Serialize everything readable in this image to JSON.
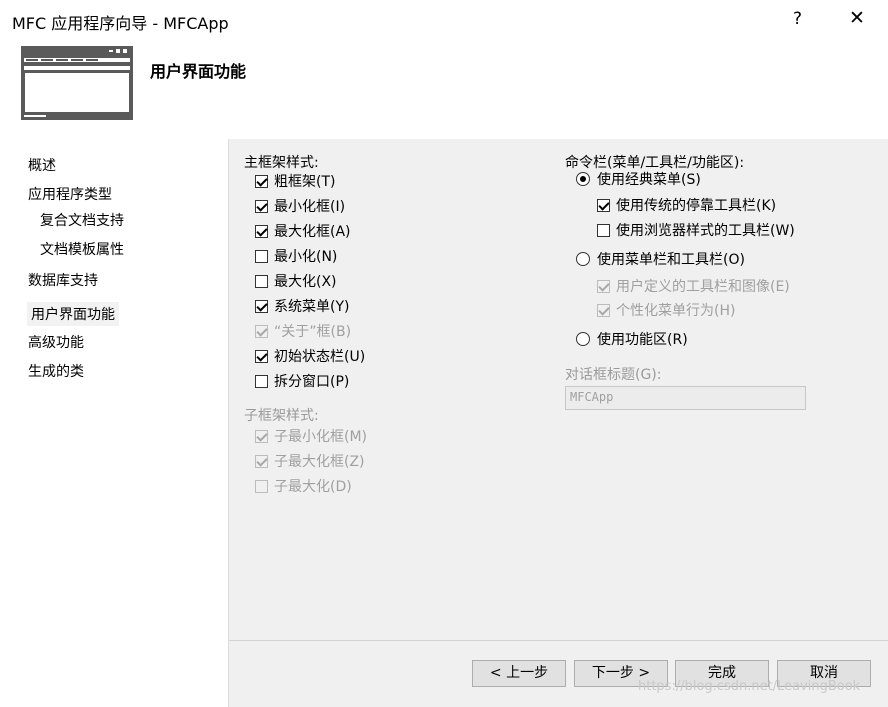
{
  "window": {
    "title": "MFC 应用程序向导 - MFCApp",
    "help_label": "?",
    "close_label": "✕"
  },
  "header": {
    "page_title": "用户界面功能"
  },
  "sidebar": {
    "items": [
      {
        "label": "概述"
      },
      {
        "label": "应用程序类型"
      },
      {
        "label": "复合文档支持"
      },
      {
        "label": "文档模板属性"
      },
      {
        "label": "数据库支持"
      },
      {
        "label": "用户界面功能",
        "selected": true
      },
      {
        "label": "高级功能"
      },
      {
        "label": "生成的类"
      }
    ]
  },
  "main_frame": {
    "label": "主框架样式:",
    "options": [
      {
        "label": "粗框架(T)",
        "checked": true,
        "enabled": true
      },
      {
        "label": "最小化框(I)",
        "checked": true,
        "enabled": true
      },
      {
        "label": "最大化框(A)",
        "checked": true,
        "enabled": true
      },
      {
        "label": "最小化(N)",
        "checked": false,
        "enabled": true
      },
      {
        "label": "最大化(X)",
        "checked": false,
        "enabled": true
      },
      {
        "label": "系统菜单(Y)",
        "checked": true,
        "enabled": true
      },
      {
        "label": "“关于”框(B)",
        "checked": true,
        "enabled": false
      },
      {
        "label": "初始状态栏(U)",
        "checked": true,
        "enabled": true
      },
      {
        "label": "拆分窗口(P)",
        "checked": false,
        "enabled": true
      }
    ]
  },
  "child_frame": {
    "label": "子框架样式:",
    "options": [
      {
        "label": "子最小化框(M)",
        "checked": true,
        "enabled": false
      },
      {
        "label": "子最大化框(Z)",
        "checked": true,
        "enabled": false
      },
      {
        "label": "子最大化(D)",
        "checked": false,
        "enabled": false
      }
    ]
  },
  "command_bar": {
    "label": "命令栏(菜单/工具栏/功能区):",
    "classic_menu": {
      "label": "使用经典菜单(S)",
      "selected": true
    },
    "legacy_toolbar": {
      "label": "使用传统的停靠工具栏(K)",
      "checked": true
    },
    "browser_toolbar": {
      "label": "使用浏览器样式的工具栏(W)",
      "checked": false
    },
    "menubar_toolbar": {
      "label": "使用菜单栏和工具栏(O)",
      "selected": false
    },
    "user_defined": {
      "label": "用户定义的工具栏和图像(E)",
      "checked": true
    },
    "personalized": {
      "label": "个性化菜单行为(H)",
      "checked": true
    },
    "ribbon": {
      "label": "使用功能区(R)",
      "selected": false
    }
  },
  "dialog_title": {
    "label": "对话框标题(G):",
    "value": "MFCApp"
  },
  "buttons": {
    "back": "< 上一步",
    "next": "下一步 >",
    "finish": "完成",
    "cancel": "取消"
  },
  "watermark": "https://blog.csdn.net/LeavingBook"
}
